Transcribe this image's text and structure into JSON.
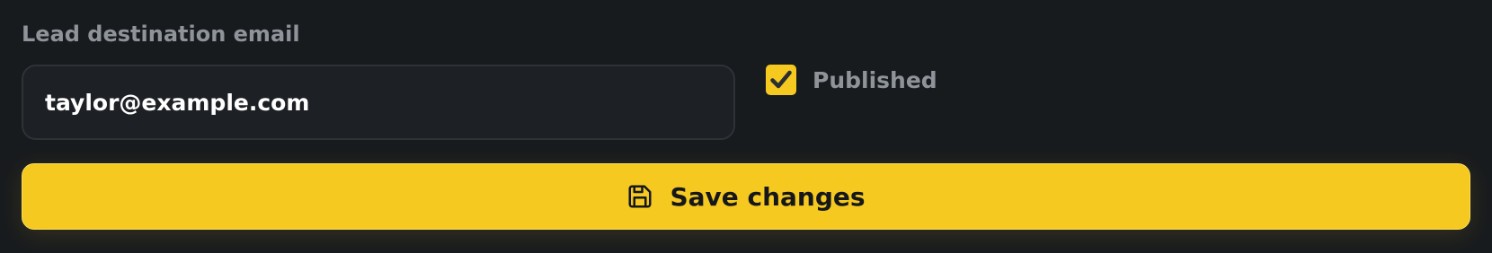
{
  "form": {
    "email": {
      "label": "Lead destination email",
      "value": "taylor@example.com"
    },
    "published": {
      "label": "Published",
      "checked": true
    },
    "save_button": {
      "label": "Save changes",
      "icon": "save-icon"
    }
  },
  "colors": {
    "background": "#181b1e",
    "accent": "#f5c920",
    "muted_text": "#8f949b",
    "input_background": "#1d2024"
  }
}
